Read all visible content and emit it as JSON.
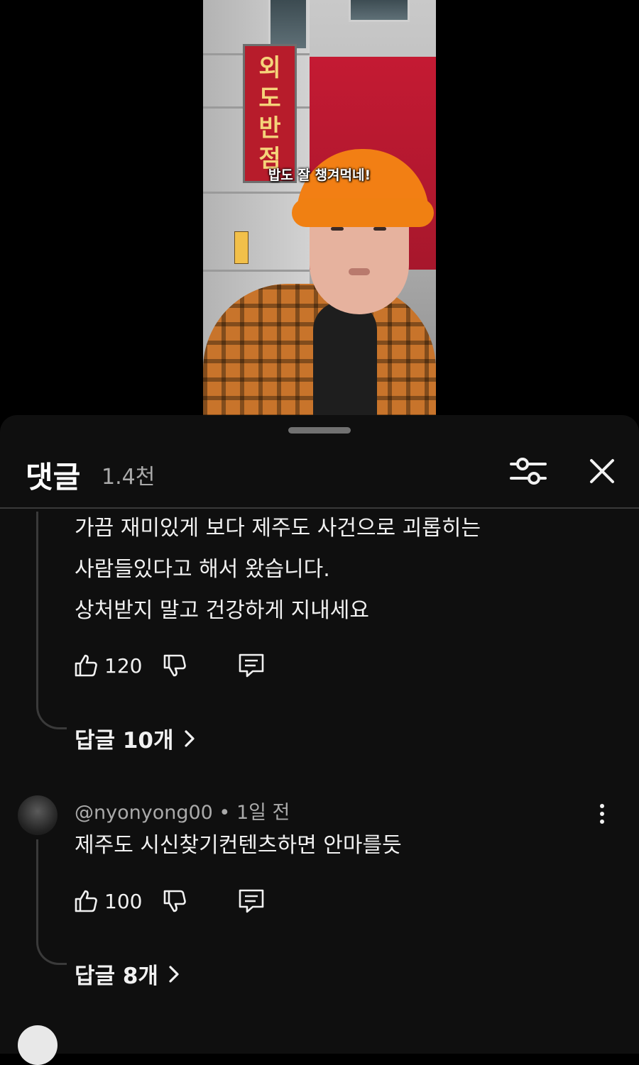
{
  "video": {
    "caption": "밥도 잘 챙겨먹네!",
    "sign_chars": [
      "외",
      "도",
      "반",
      "점"
    ]
  },
  "comments_panel": {
    "title": "댓글",
    "count": "1.4천",
    "filter_icon": "sliders-icon",
    "close_icon": "close-icon"
  },
  "comments": [
    {
      "text_lines": [
        "가끔 재미있게 보다 제주도 사건으로 괴롭히는",
        "사람들있다고 해서 왔습니다.",
        "상처받지 말고 건강하게 지내세요"
      ],
      "likes": "120",
      "replies_label": "답글 10개"
    },
    {
      "author": "@nyonyong00",
      "separator": "•",
      "time": "1일 전",
      "text": "제주도 시신찾기컨텐츠하면 안마를듯",
      "likes": "100",
      "replies_label": "답글 8개"
    }
  ],
  "icons": {
    "like": "thumbs-up-icon",
    "dislike": "thumbs-down-icon",
    "reply": "comment-reply-icon",
    "more": "more-vertical-icon",
    "chevron": "chevron-right-icon"
  },
  "colors": {
    "sheet_background": "#0f0f0f",
    "primary_text": "#f1f1f1",
    "secondary_text": "#aaaaaa",
    "hat_orange": "#f27f14"
  }
}
